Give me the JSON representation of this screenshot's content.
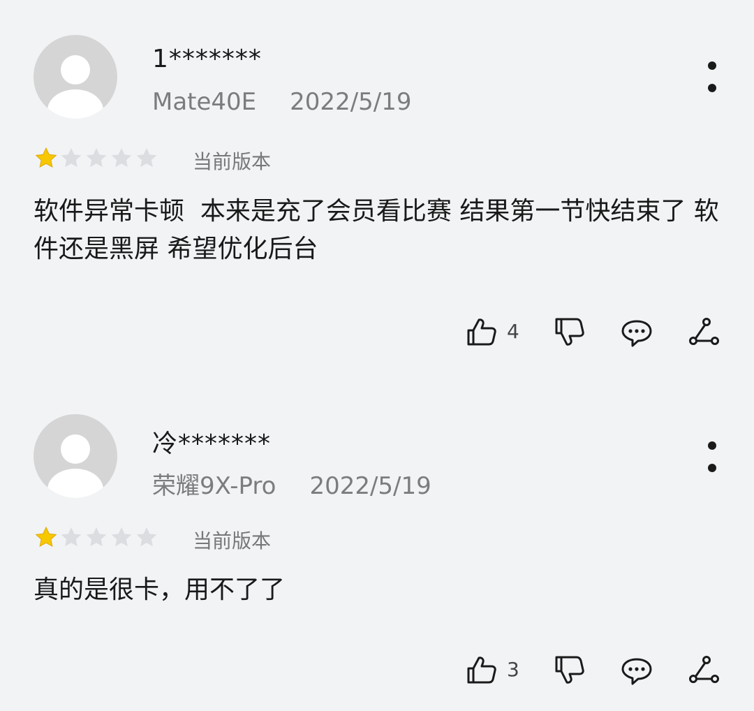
{
  "colors": {
    "background": "#f1f3f5",
    "star_filled": "#f7c700",
    "star_empty": "#dcdde0",
    "avatar_bg": "#d5d5d5",
    "avatar_fg": "#ffffff"
  },
  "icons": {
    "like": "thumb-up-icon",
    "dislike": "thumb-down-icon",
    "reply": "comment-bubble-icon",
    "share": "share-icon",
    "more": "more-vertical-icon",
    "star": "star-icon"
  },
  "reviews": [
    {
      "username": "1*******",
      "device": "Mate40E",
      "date": "2022/5/19",
      "rating": 1,
      "rating_max": 5,
      "version": "当前版本",
      "content": "软件异常卡顿  本来是充了会员看比赛 结果第一节快结束了 软件还是黑屏 希望优化后台",
      "likes": "4"
    },
    {
      "username": "冷*******",
      "device": "荣耀9X-Pro",
      "date": "2022/5/19",
      "rating": 1,
      "rating_max": 5,
      "version": "当前版本",
      "content": "真的是很卡，用不了了",
      "likes": "3"
    }
  ]
}
